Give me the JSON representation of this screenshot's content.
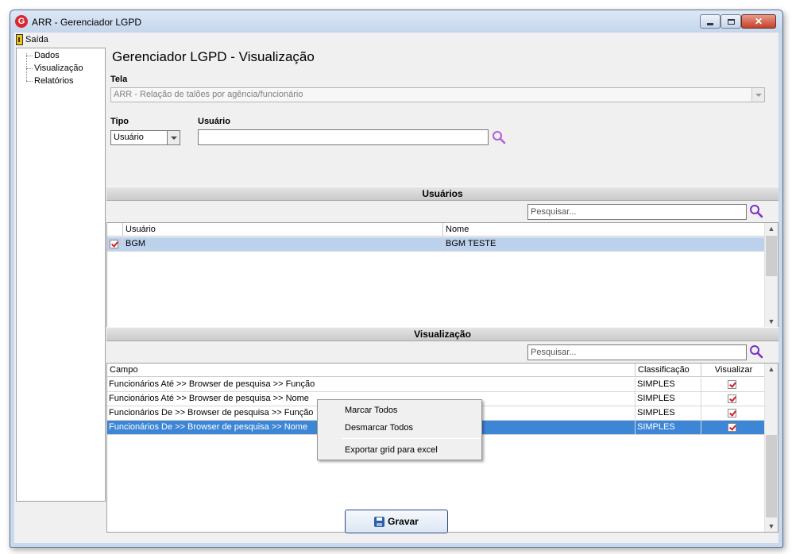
{
  "window": {
    "title": "ARR - Gerenciador LGPD",
    "app_icon_letter": "G"
  },
  "menu": {
    "saida": "Saída"
  },
  "tree": {
    "items": [
      "Dados",
      "Visualização",
      "Relatórios"
    ]
  },
  "main": {
    "title": "Gerenciador LGPD - Visualização",
    "tela_label": "Tela",
    "tela_value": "ARR - Relação de talões por agência/funcionário",
    "tipo_label": "Tipo",
    "tipo_value": "Usuário",
    "usuario_label": "Usuário",
    "usuario_value": ""
  },
  "usuarios": {
    "header": "Usuários",
    "search_placeholder": "Pesquisar...",
    "columns": [
      "Usuário",
      "Nome"
    ],
    "rows": [
      {
        "usuario": "BGM",
        "nome": "BGM TESTE",
        "checked": true
      }
    ]
  },
  "visualizacao": {
    "header": "Visualização",
    "search_placeholder": "Pesquisar...",
    "columns": [
      "Campo",
      "Classificação",
      "Visualizar"
    ],
    "rows": [
      {
        "campo": "Funcionários Até >> Browser de pesquisa >> Função",
        "classificacao": "SIMPLES",
        "visualizar": true
      },
      {
        "campo": "Funcionários Até >> Browser de pesquisa >> Nome",
        "classificacao": "SIMPLES",
        "visualizar": true
      },
      {
        "campo": "Funcionários De >> Browser de pesquisa >> Função",
        "classificacao": "SIMPLES",
        "visualizar": true
      },
      {
        "campo": "Funcionários De >> Browser de pesquisa >> Nome",
        "classificacao": "SIMPLES",
        "visualizar": true
      }
    ]
  },
  "context_menu": {
    "items": [
      "Marcar Todos",
      "Desmarcar Todos",
      "Exportar grid para excel"
    ]
  },
  "footer": {
    "gravar_label": "Gravar"
  },
  "colors": {
    "selected_row_user": "#bcd1ec",
    "selected_row_blue": "#3d86d6",
    "check_mark": "#d1202a",
    "search_icon": "#7a2fc4"
  }
}
